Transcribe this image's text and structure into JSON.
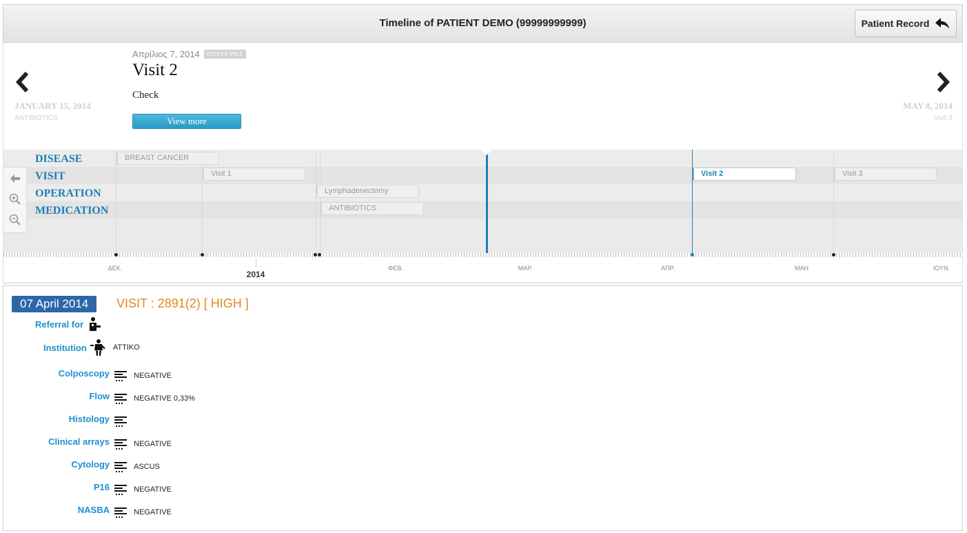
{
  "header": {
    "title": "Timeline of PATIENT DEMO (99999999999)",
    "record_button": "Patient Record"
  },
  "story": {
    "date": "Απρίλιος 7, 2014",
    "tag": "ΕΠΙΣΚΕΨΕΙΣ",
    "headline": "Visit 2",
    "description": "Check",
    "view_more": "View more",
    "prev": {
      "date": "JANUARY 15, 2014",
      "subtitle": "ANTIBIOTICS"
    },
    "next": {
      "date": "MAY 8, 2014",
      "subtitle": "Visit 3"
    }
  },
  "timeline": {
    "categories": [
      "DISEASE",
      "VISIT",
      "OPERATION",
      "MEDICATION"
    ],
    "markers": {
      "breast_cancer": "BREAST CANCER",
      "visit1": "Visit 1",
      "visit2": "Visit 2",
      "visit3": "Visit 3",
      "lymph": "Lymphadenectomy",
      "antibiotics": "ANTIBIOTICS"
    },
    "months": [
      "ΔΕΚ.",
      "ΦΕΒ.",
      "ΜΑΡ.",
      "ΑΠΡ.",
      "ΜΑΗ",
      "ΙΟΥΝ."
    ],
    "year": "2014",
    "controls": [
      "back-icon",
      "zoom-in-icon",
      "zoom-out-icon"
    ]
  },
  "details": {
    "date": "07 April 2014",
    "title": "VISIT : 2891(2) [ HIGH ]",
    "referral_label": "Referral for",
    "institution_label": "Institution",
    "institution_value": "ATTIKO",
    "fields": [
      {
        "label": "Colposcopy",
        "value": "NEGATIVE"
      },
      {
        "label": "Flow",
        "value": "NEGATIVE 0,33%"
      },
      {
        "label": "Histology",
        "value": ""
      },
      {
        "label": "Clinical arrays",
        "value": "NEGATIVE"
      },
      {
        "label": "Cytology",
        "value": "ASCUS"
      },
      {
        "label": "P16",
        "value": "NEGATIVE"
      },
      {
        "label": "NASBA",
        "value": "NEGATIVE"
      }
    ]
  }
}
